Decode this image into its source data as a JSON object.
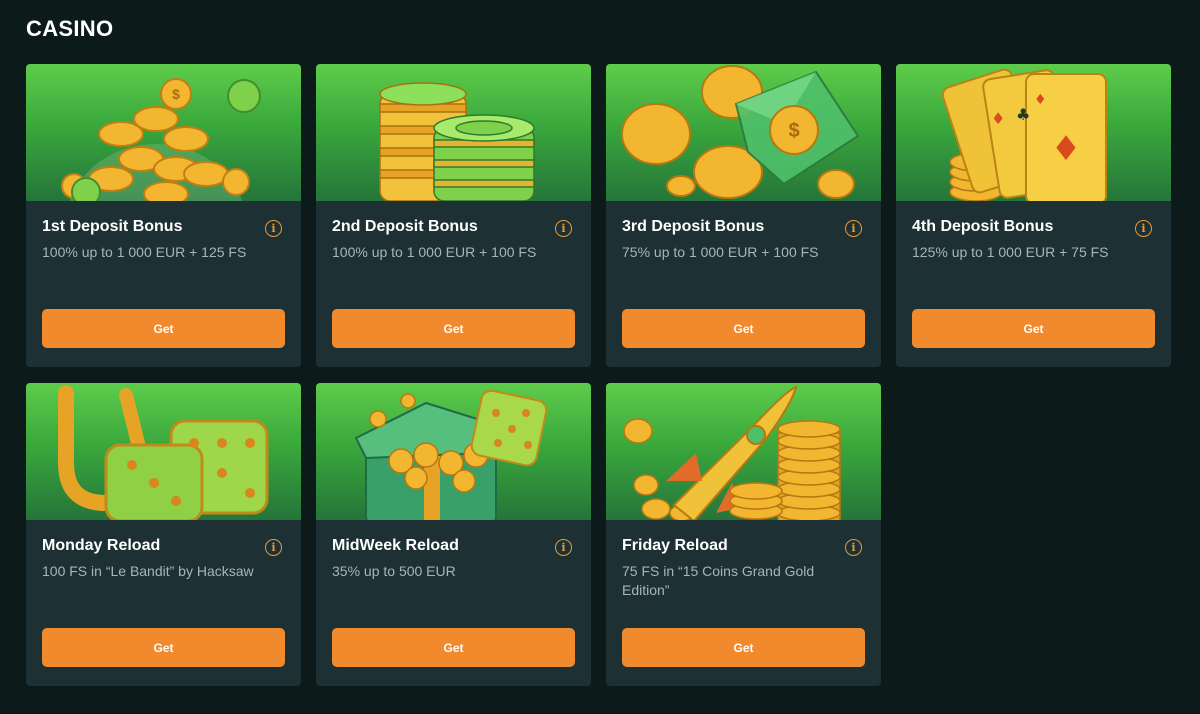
{
  "section": {
    "title": "CASINO"
  },
  "colors": {
    "background": "#0c1a1a",
    "card": "#1d3034",
    "accent": "#f08a2c",
    "art_green": "#4cba44"
  },
  "cards": [
    {
      "title": "1st Deposit Bonus",
      "description": "100% up to 1 000 EUR + 125 FS",
      "button": "Get",
      "info": "i",
      "art": "coins-jar"
    },
    {
      "title": "2nd Deposit Bonus",
      "description": "100% up to 1 000 EUR + 100 FS",
      "button": "Get",
      "info": "i",
      "art": "chip-stacks"
    },
    {
      "title": "3rd Deposit Bonus",
      "description": "75% up to 1 000 EUR + 100 FS",
      "button": "Get",
      "info": "i",
      "art": "gem-coins"
    },
    {
      "title": "4th Deposit Bonus",
      "description": "125% up to 1 000 EUR + 75 FS",
      "button": "Get",
      "info": "i",
      "art": "playing-cards"
    },
    {
      "title": "Monday Reload",
      "description": "100 FS in “Le Bandit” by Hacksaw",
      "button": "Get",
      "info": "i",
      "art": "horseshoe-dice"
    },
    {
      "title": "MidWeek Reload",
      "description": "35% up to 500 EUR",
      "button": "Get",
      "info": "i",
      "art": "gift-box-dice"
    },
    {
      "title": "Friday Reload",
      "description": "75 FS in “15 Coins Grand Gold Edition”",
      "button": "Get",
      "info": "i",
      "art": "rocket-coins"
    }
  ]
}
